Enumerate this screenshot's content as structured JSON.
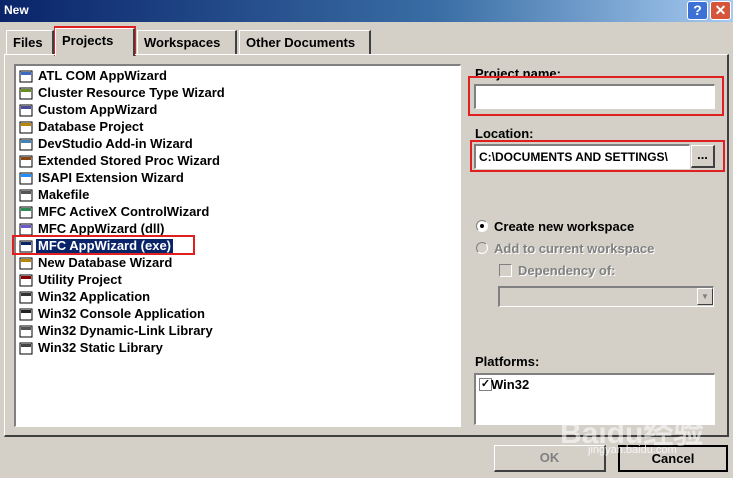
{
  "window": {
    "title": "New",
    "help_button": "?",
    "close_button": "✕"
  },
  "tabs": [
    {
      "label": "Files"
    },
    {
      "label": "Projects"
    },
    {
      "label": "Workspaces"
    },
    {
      "label": "Other Documents"
    }
  ],
  "project_list": {
    "items": [
      {
        "label": "ATL COM AppWizard",
        "icon": "atl-com-icon"
      },
      {
        "label": "Cluster Resource Type Wizard",
        "icon": "cluster-icon"
      },
      {
        "label": "Custom AppWizard",
        "icon": "custom-wizard-icon"
      },
      {
        "label": "Database Project",
        "icon": "database-icon"
      },
      {
        "label": "DevStudio Add-in Wizard",
        "icon": "addin-icon"
      },
      {
        "label": "Extended Stored Proc Wizard",
        "icon": "stored-proc-icon"
      },
      {
        "label": "ISAPI Extension Wizard",
        "icon": "globe-icon"
      },
      {
        "label": "Makefile",
        "icon": "makefile-icon"
      },
      {
        "label": "MFC ActiveX ControlWizard",
        "icon": "activex-icon"
      },
      {
        "label": "MFC AppWizard (dll)",
        "icon": "mfc-dll-icon"
      },
      {
        "label": "MFC AppWizard (exe)",
        "icon": "mfc-exe-icon",
        "selected": true
      },
      {
        "label": "New Database Wizard",
        "icon": "new-database-icon"
      },
      {
        "label": "Utility Project",
        "icon": "utility-icon"
      },
      {
        "label": "Win32 Application",
        "icon": "win32-app-icon"
      },
      {
        "label": "Win32 Console Application",
        "icon": "console-icon"
      },
      {
        "label": "Win32 Dynamic-Link Library",
        "icon": "dll-icon"
      },
      {
        "label": "Win32 Static Library",
        "icon": "static-lib-icon"
      }
    ]
  },
  "project_name": {
    "label": "Project name:",
    "value": ""
  },
  "location": {
    "label": "Location:",
    "value": "C:\\DOCUMENTS AND SETTINGS\\",
    "browse_label": "..."
  },
  "workspace": {
    "create_new": "Create new workspace",
    "add_current": "Add to current workspace",
    "dependency": "Dependency of:",
    "dependency_value": ""
  },
  "platforms": {
    "label": "Platforms:",
    "items": [
      {
        "label": "Win32",
        "checked": true
      }
    ]
  },
  "buttons": {
    "ok": "OK",
    "cancel": "Cancel"
  },
  "watermark": {
    "text": "Baidu经验",
    "sub": "jingyan.baidu.com"
  },
  "colors": {
    "highlight": "#e02020",
    "selection": "#0a246a",
    "face": "#d4d0c8"
  }
}
